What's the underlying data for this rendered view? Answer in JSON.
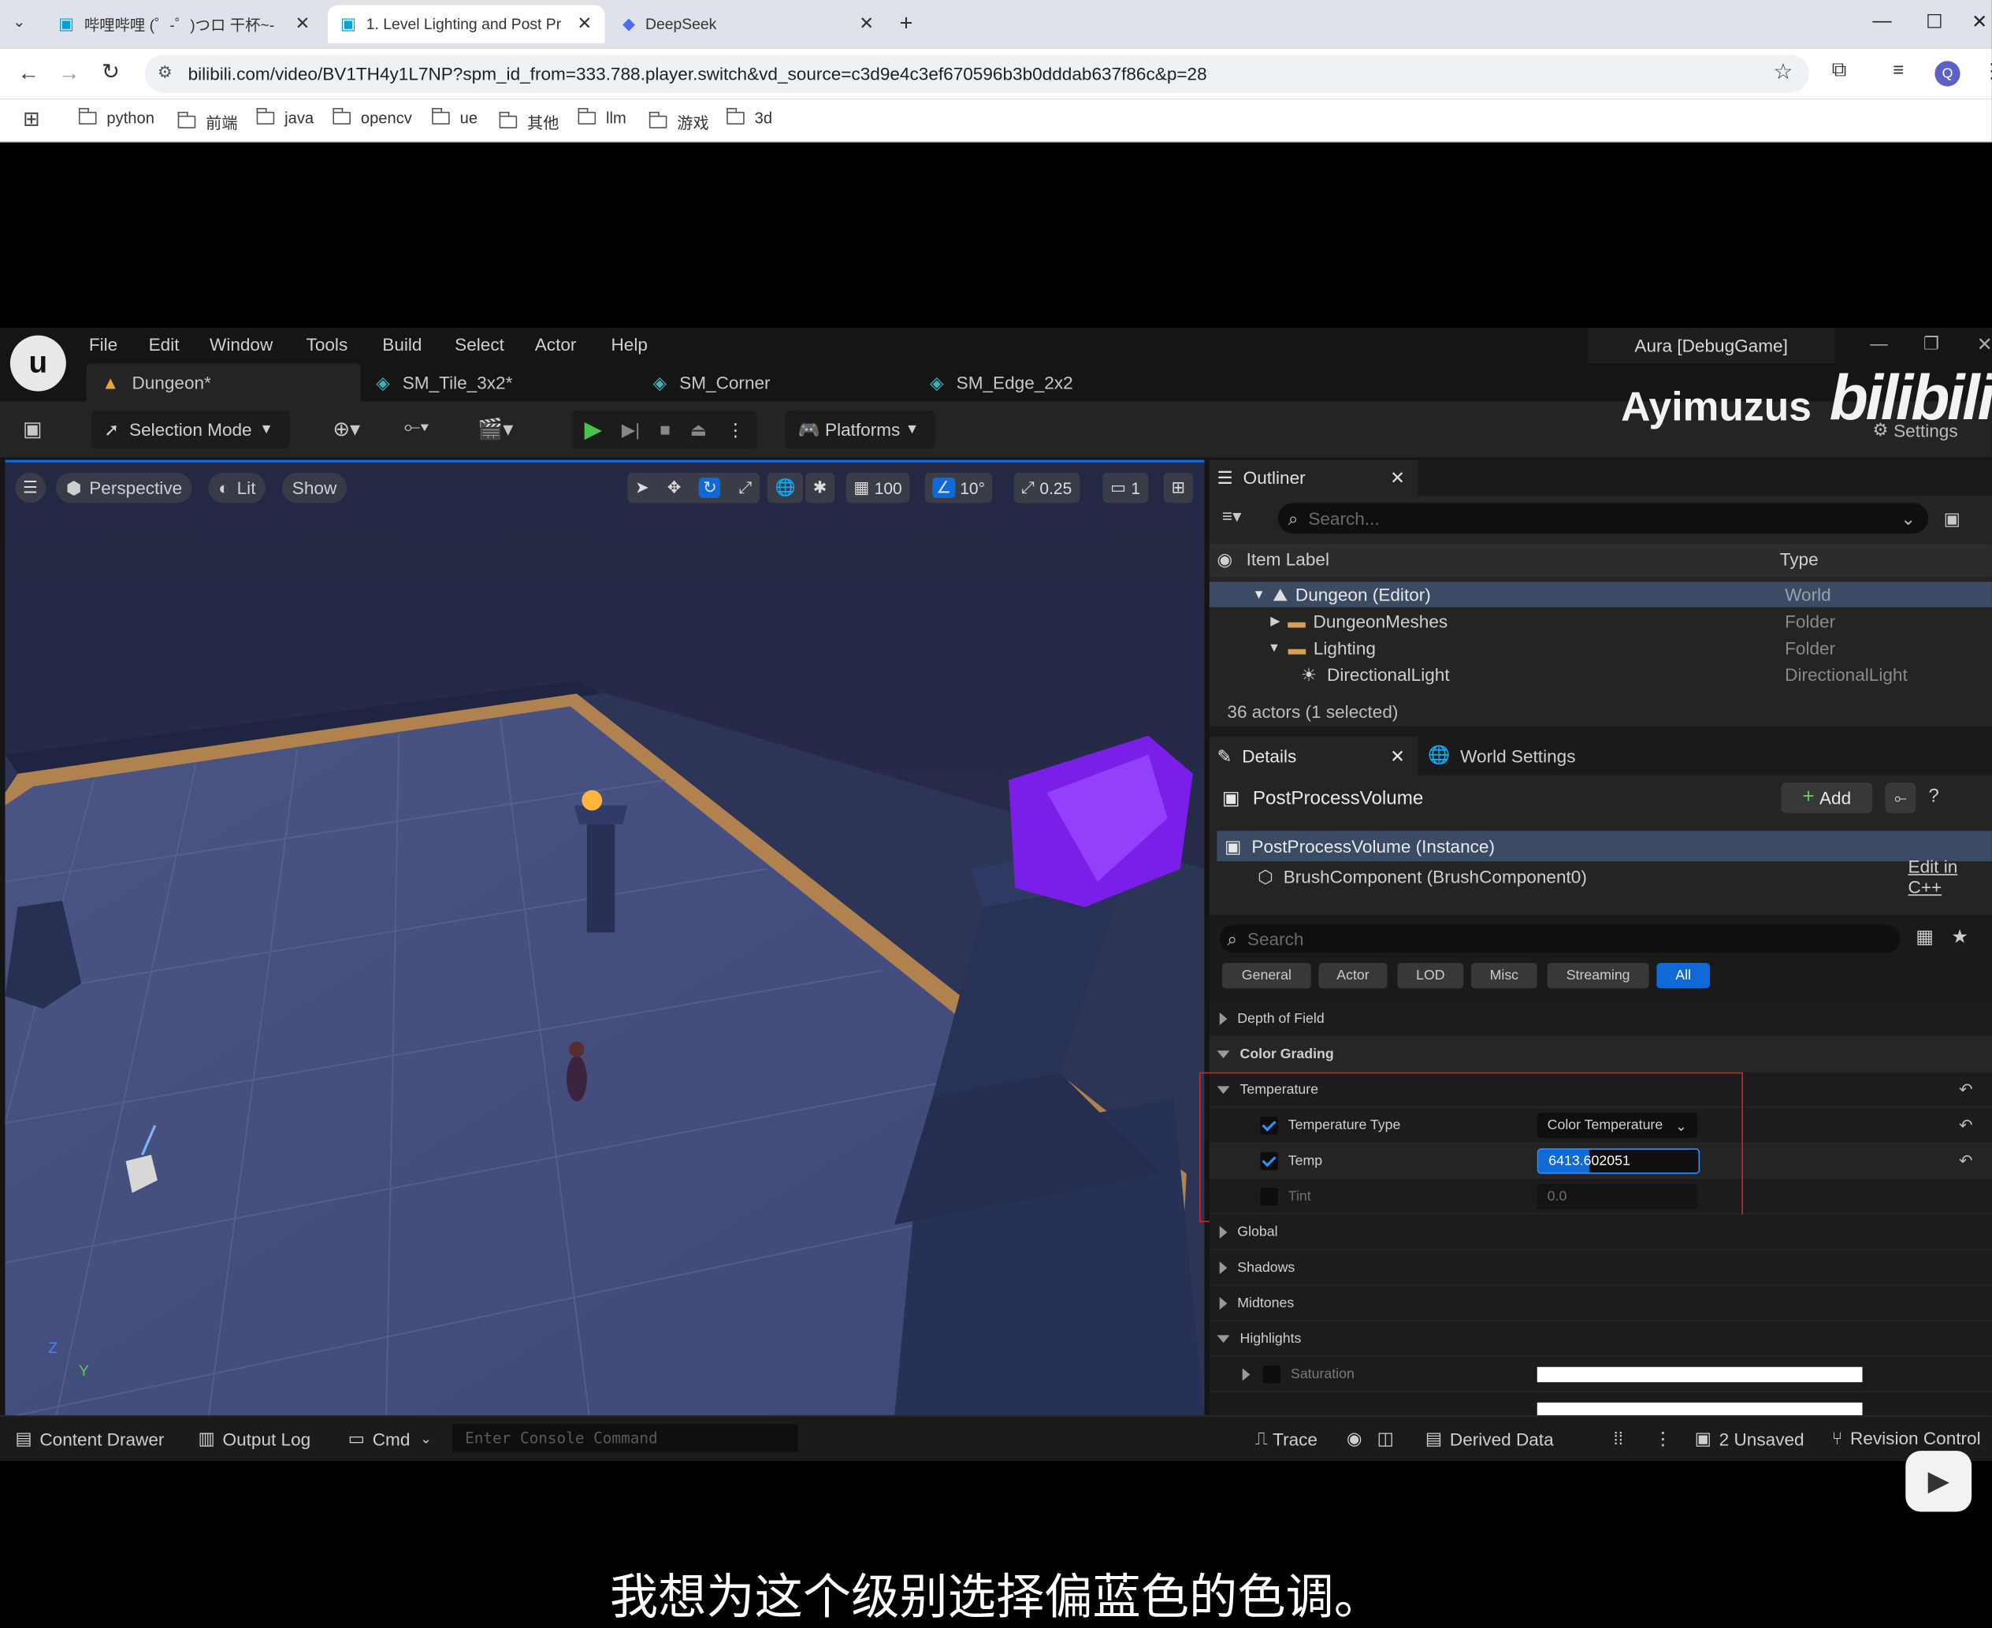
{
  "browser": {
    "tabs": [
      {
        "title": "哔哩哔哩 (゜-゜)つロ 干杯~-bi"
      },
      {
        "title": "1. Level Lighting and Post Pr"
      },
      {
        "title": "DeepSeek"
      }
    ],
    "url": "bilibili.com/video/BV1TH4y1L7NP?spm_id_from=333.788.player.switch&vd_source=c3d9e4c3ef670596b3b0dddab637f86c&p=28",
    "profile_letter": "Q",
    "bookmarks": [
      "python",
      "前端",
      "java",
      "opencv",
      "ue",
      "其他",
      "llm",
      "游戏",
      "3d"
    ]
  },
  "ue": {
    "menu": [
      "File",
      "Edit",
      "Window",
      "Tools",
      "Build",
      "Select",
      "Actor",
      "Help"
    ],
    "project": "Aura [DebugGame]",
    "watermark_user": "Ayimuzus",
    "watermark_brand": "bilibili",
    "doc_tabs": [
      "Dungeon*",
      "SM_Tile_3x2*",
      "SM_Corner",
      "SM_Edge_2x2"
    ],
    "toolbar": {
      "selection_mode": "Selection Mode",
      "platforms": "Platforms",
      "settings": "Settings"
    },
    "viewport": {
      "perspective": "Perspective",
      "lit": "Lit",
      "show": "Show",
      "grid": "100",
      "angle": "10°",
      "scale": "0.25",
      "camera": "1",
      "axis_z": "Z",
      "axis_y": "Y"
    },
    "outliner": {
      "title": "Outliner",
      "search_placeholder": "Search...",
      "col_label": "Item Label",
      "col_type": "Type",
      "items": [
        {
          "label": "Dungeon (Editor)",
          "type": "World"
        },
        {
          "label": "DungeonMeshes",
          "type": "Folder"
        },
        {
          "label": "Lighting",
          "type": "Folder"
        },
        {
          "label": "DirectionalLight",
          "type": "DirectionalLight"
        }
      ],
      "count": "36 actors (1 selected)"
    },
    "details": {
      "tab": "Details",
      "world_settings": "World Settings",
      "object": "PostProcessVolume",
      "add": "Add",
      "instance": "PostProcessVolume (Instance)",
      "component": "BrushComponent (BrushComponent0)",
      "edit_cpp": "Edit in C++",
      "search_placeholder": "Search",
      "filters": [
        "General",
        "Actor",
        "LOD",
        "Misc",
        "Streaming",
        "All"
      ],
      "categories": {
        "depth_of_field": "Depth of Field",
        "color_grading": "Color Grading",
        "temperature": "Temperature",
        "temperature_type": "Temperature Type",
        "temperature_type_value": "Color Temperature",
        "temp": "Temp",
        "temp_value": "6413.602051",
        "tint": "Tint",
        "tint_value": "0.0",
        "global": "Global",
        "shadows": "Shadows",
        "midtones": "Midtones",
        "highlights": "Highlights",
        "saturation": "Saturation"
      }
    },
    "status": {
      "content_drawer": "Content Drawer",
      "output_log": "Output Log",
      "cmd": "Cmd",
      "console_placeholder": "Enter Console Command",
      "trace": "Trace",
      "derived_data": "Derived Data",
      "unsaved": "2 Unsaved",
      "revision": "Revision Control"
    }
  },
  "subtitle": "我想为这个级别选择偏蓝色的色调。",
  "colors": {
    "accent": "#0f6ad8",
    "highlight_box": "#c62828",
    "selected_row": "#3c4b63"
  }
}
